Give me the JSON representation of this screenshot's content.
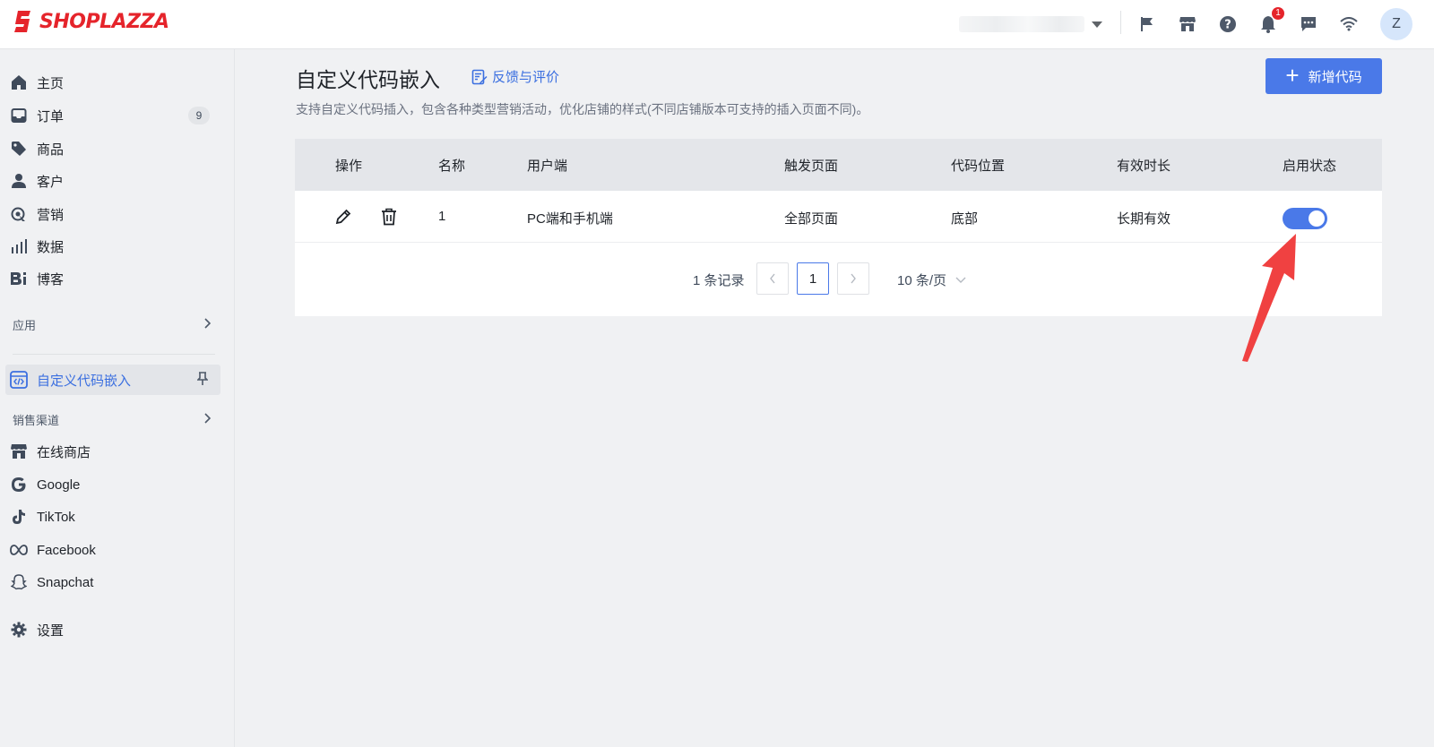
{
  "brand": {
    "name": "SHOPLAZZA",
    "color": "#e5242b"
  },
  "header": {
    "store_name": "",
    "icons": [
      "flag-icon",
      "store-icon",
      "help-icon",
      "bell-icon",
      "message-icon",
      "wifi-icon"
    ],
    "notification_count": "1",
    "avatar_initial": "Z"
  },
  "sidebar": {
    "items": [
      {
        "label": "主页",
        "icon": "home-icon"
      },
      {
        "label": "订单",
        "icon": "inbox-icon",
        "badge": "9"
      },
      {
        "label": "商品",
        "icon": "tag-icon"
      },
      {
        "label": "客户",
        "icon": "user-icon"
      },
      {
        "label": "营销",
        "icon": "marketing-icon"
      },
      {
        "label": "数据",
        "icon": "bar-chart-icon"
      },
      {
        "label": "博客",
        "icon": "blog-icon"
      }
    ],
    "apps_section": "应用",
    "active_app": "自定义代码嵌入",
    "channels_section": "销售渠道",
    "channels": [
      {
        "label": "在线商店",
        "icon": "store-icon"
      },
      {
        "label": "Google",
        "icon": "google-icon"
      },
      {
        "label": "TikTok",
        "icon": "tiktok-icon"
      },
      {
        "label": "Facebook",
        "icon": "meta-icon"
      },
      {
        "label": "Snapchat",
        "icon": "snapchat-icon"
      }
    ],
    "settings": "设置"
  },
  "main": {
    "title": "自定义代码嵌入",
    "feedback_link": "反馈与评价",
    "add_button": "新增代码",
    "subtitle": "支持自定义代码插入，包含各种类型营销活动，优化店铺的样式(不同店铺版本可支持的插入页面不同)。",
    "accent": "#4a79e8",
    "table": {
      "columns": [
        "操作",
        "名称",
        "用户端",
        "触发页面",
        "代码位置",
        "有效时长",
        "启用状态"
      ],
      "rows": [
        {
          "name": "1",
          "client": "PC端和手机端",
          "trigger_page": "全部页面",
          "position": "底部",
          "duration": "长期有效",
          "enabled": true
        }
      ]
    },
    "pagination": {
      "total": "1 条记录",
      "current_page": "1",
      "page_size": "10 条/页"
    }
  }
}
